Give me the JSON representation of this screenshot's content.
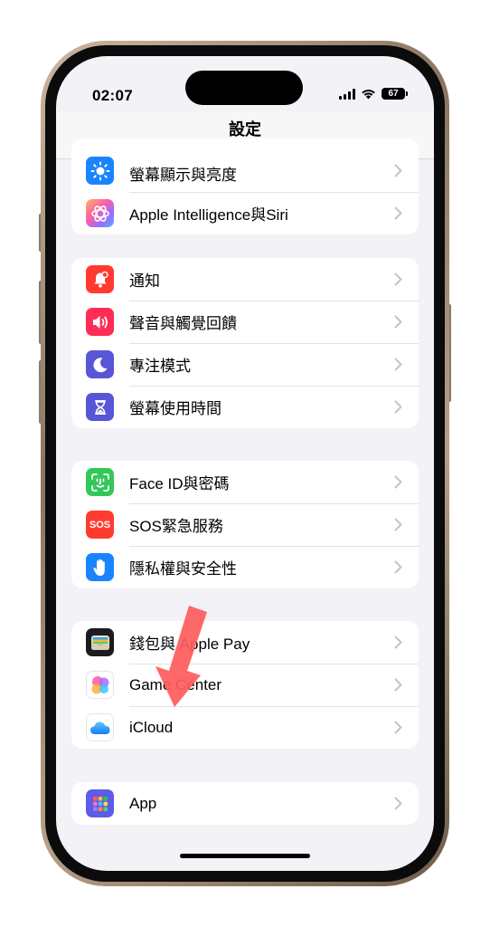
{
  "status_bar": {
    "time": "02:07",
    "battery": "67"
  },
  "nav": {
    "title": "設定"
  },
  "groups": [
    {
      "items": [
        {
          "label": "螢幕顯示與亮度",
          "icon": "sun-icon",
          "color": "#1a84ff"
        },
        {
          "label": "Apple Intelligence與Siri",
          "icon": "apple-intelligence-icon",
          "color": "#ffffff"
        }
      ]
    },
    {
      "items": [
        {
          "label": "通知",
          "icon": "bell-icon",
          "color": "#ff3b30"
        },
        {
          "label": "聲音與觸覺回饋",
          "icon": "speaker-icon",
          "color": "#ff2d55"
        },
        {
          "label": "專注模式",
          "icon": "moon-icon",
          "color": "#5856d6"
        },
        {
          "label": "螢幕使用時間",
          "icon": "hourglass-icon",
          "color": "#5856d6"
        }
      ]
    },
    {
      "items": [
        {
          "label": "Face ID與密碼",
          "icon": "face-id-icon",
          "color": "#34c759"
        },
        {
          "label": "SOS緊急服務",
          "icon": "sos-icon",
          "color": "#ff3b30",
          "badge": "SOS"
        },
        {
          "label": "隱私權與安全性",
          "icon": "hand-icon",
          "color": "#1a84ff"
        }
      ]
    },
    {
      "items": [
        {
          "label": "錢包與 Apple Pay",
          "icon": "wallet-icon",
          "color": "#1c1c1e"
        },
        {
          "label": "Game Center",
          "icon": "game-center-icon",
          "color": "#ffffff"
        },
        {
          "label": "iCloud",
          "icon": "icloud-icon",
          "color": "#ffffff"
        }
      ]
    },
    {
      "items": [
        {
          "label": "App",
          "icon": "app-grid-icon",
          "color": "#5e5ce6"
        }
      ]
    }
  ],
  "annotation": {
    "arrow_color": "#ff5c5c",
    "arrow_points_to": "iCloud"
  }
}
